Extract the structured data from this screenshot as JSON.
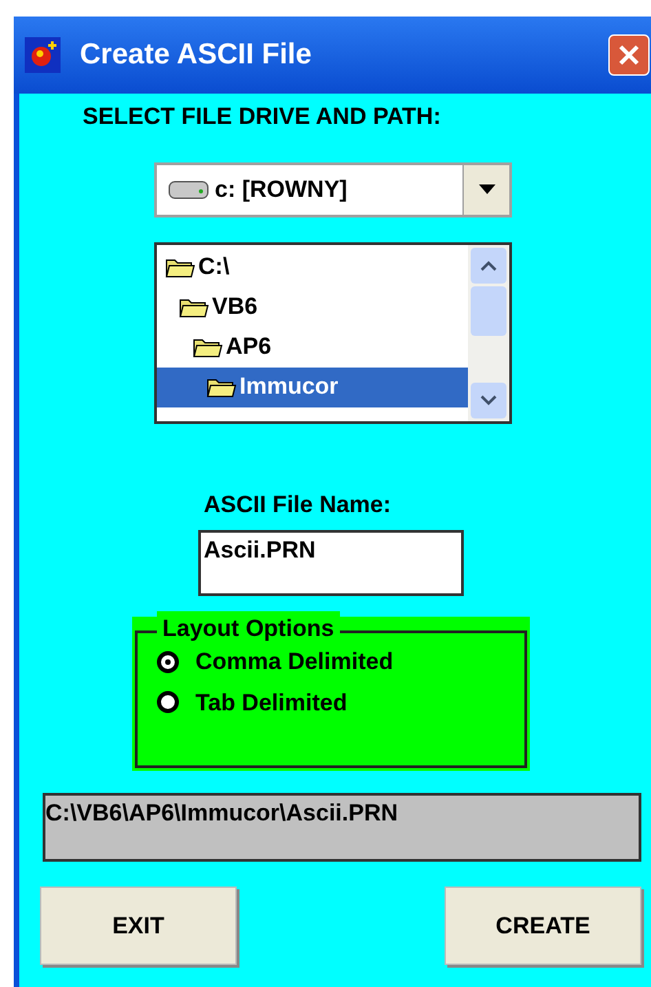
{
  "window": {
    "title": "Create ASCII File"
  },
  "path_heading": "SELECT FILE DRIVE AND PATH:",
  "drive_select": {
    "value": "c: [ROWNY]"
  },
  "folder_tree": [
    {
      "label": "C:\\",
      "selected": false,
      "children": [
        {
          "label": "VB6",
          "selected": false,
          "children": [
            {
              "label": "AP6",
              "selected": false,
              "children": [
                {
                  "label": "Immucor",
                  "selected": true
                }
              ]
            }
          ]
        }
      ]
    }
  ],
  "file_name": {
    "label": "ASCII File Name:",
    "value": "Ascii.PRN"
  },
  "layout_options": {
    "title": "Layout Options",
    "options": [
      {
        "label": "Comma Delimited",
        "selected": true
      },
      {
        "label": "Tab Delimited",
        "selected": false
      }
    ]
  },
  "full_path": "C:\\VB6\\AP6\\Immucor\\Ascii.PRN",
  "buttons": [
    "EXIT",
    "CREATE"
  ]
}
